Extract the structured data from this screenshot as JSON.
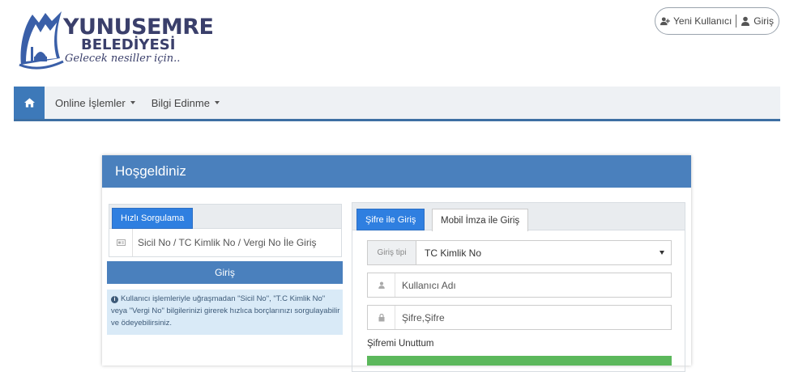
{
  "header": {
    "logo_title": "YUNUSEMRE",
    "logo_subtitle": "BELEDİYESİ",
    "logo_slogan": "Gelecek nesiller için..",
    "new_user_label": "Yeni Kullanıcı",
    "login_label": "Giriş"
  },
  "nav": {
    "items": [
      {
        "label": "Online İşlemler"
      },
      {
        "label": "Bilgi Edinme"
      }
    ]
  },
  "panel": {
    "title": "Hoşgeldiniz",
    "quick": {
      "tab_label": "Hızlı Sorgulama",
      "input_placeholder": "Sicil No / TC Kimlik No / Vergi No İle Giriş",
      "button_label": "Giriş",
      "info_text": "Kullanıcı işlemleriyle uğraşmadan \"Sicil No\", \"T.C Kimlik No\" veya \"Vergi No\" bilgilerinizi girerek hızlıca borçlarınızı sorgulayabilir ve ödeyebilirsiniz."
    },
    "login": {
      "tab_password": "Şifre ile Giriş",
      "tab_mobile": "Mobil İmza ile Giriş",
      "type_label": "Giriş tipi",
      "type_value": "TC Kimlik No",
      "username_placeholder": "Kullanıcı Adı",
      "password_placeholder": "Şifre,Şifre",
      "forgot_label": "Şifremi Unuttum"
    }
  },
  "colors": {
    "primary": "#4a80bd",
    "tab_active": "#2f7fe0",
    "info_bg": "#d9eaf7",
    "success": "#5cb85c",
    "logo_text": "#3a3f6b"
  }
}
